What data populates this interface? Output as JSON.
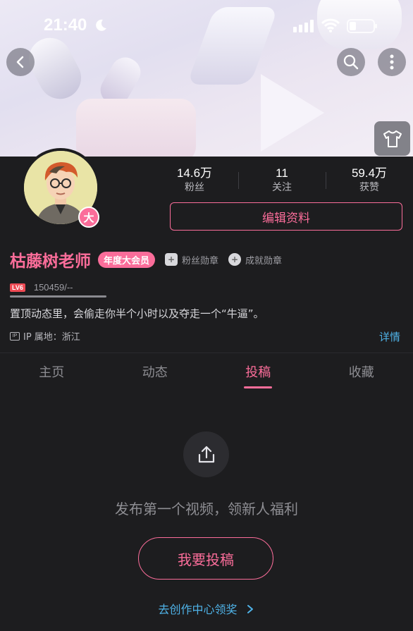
{
  "status_bar": {
    "time": "21:40"
  },
  "profile": {
    "avatar_badge": "大",
    "username": "枯藤树老师",
    "vip_tag": "年度大会员",
    "fan_medal": "粉丝勋章",
    "achievement_medal": "成就勋章",
    "level_badge": "LV6",
    "exp": "150459/--",
    "bio": "置顶动态里，会偷走你半个小时以及夺走一个“牛逼”。",
    "ip_icon": "IP",
    "ip_location": "IP 属地：浙江",
    "detail_link": "详情",
    "edit_button": "编辑资料"
  },
  "stats": [
    {
      "value": "14.6万",
      "label": "粉丝"
    },
    {
      "value": "11",
      "label": "关注"
    },
    {
      "value": "59.4万",
      "label": "获赞"
    }
  ],
  "tabs": [
    {
      "label": "主页",
      "active": false
    },
    {
      "label": "动态",
      "active": false
    },
    {
      "label": "投稿",
      "active": true
    },
    {
      "label": "收藏",
      "active": false
    }
  ],
  "empty_state": {
    "icon": "upload-icon",
    "message": "发布第一个视频，领新人福利",
    "button": "我要投稿",
    "link": "去创作中心领奖"
  },
  "colors": {
    "accent": "#fb6d9a",
    "link": "#4fb3e8",
    "background": "#1d1d1f"
  }
}
